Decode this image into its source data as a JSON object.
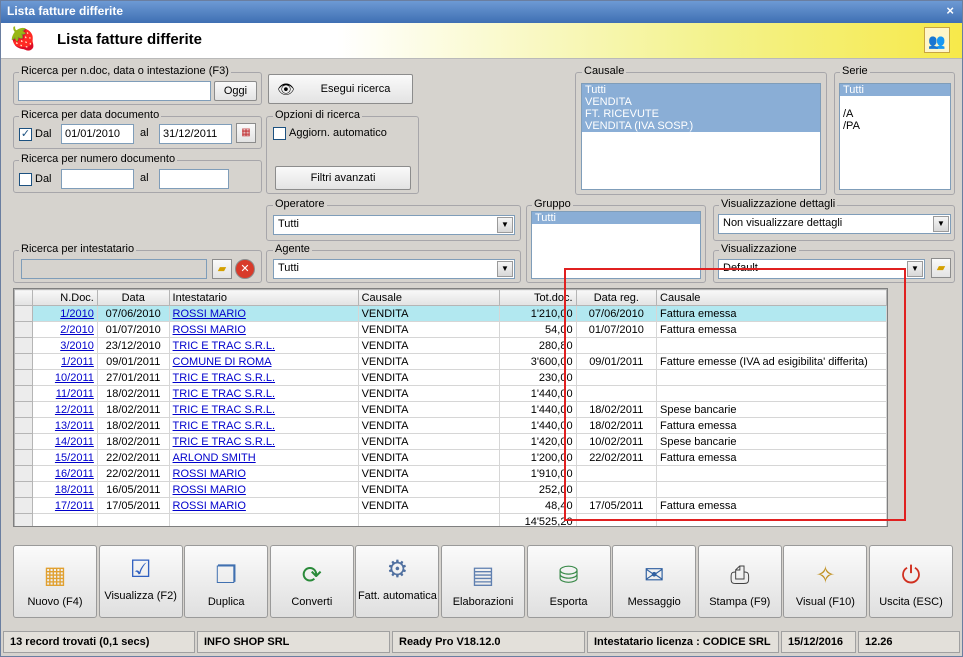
{
  "window": {
    "title": "Lista fatture differite"
  },
  "header": {
    "title": "Lista fatture differite"
  },
  "search": {
    "text_label": "Ricerca per n.doc, data o intestazione (F3)",
    "text_value": "",
    "oggi": "Oggi",
    "execute": "Esegui ricerca",
    "date_label": "Ricerca per data documento",
    "dal": "Dal",
    "al": "al",
    "date_from": "01/01/2010",
    "date_to": "31/12/2011",
    "num_label": "Ricerca per numero documento",
    "num_dal": "Dal",
    "num_al": "al",
    "intest_label": "Ricerca per intestatario"
  },
  "options": {
    "label": "Opzioni di ricerca",
    "auto_update": "Aggiorn. automatico",
    "advanced": "Filtri avanzati"
  },
  "causale": {
    "label": "Causale",
    "items": [
      "Tutti",
      "VENDITA",
      "FT. RICEVUTE",
      "VENDITA (IVA SOSP.)"
    ]
  },
  "serie": {
    "label": "Serie",
    "items": [
      "Tutti",
      "",
      "/A",
      "/PA"
    ]
  },
  "operatore": {
    "label": "Operatore",
    "value": "Tutti"
  },
  "agente": {
    "label": "Agente",
    "value": "Tutti"
  },
  "gruppo": {
    "label": "Gruppo",
    "items": [
      "Tutti"
    ]
  },
  "vis_dettagli": {
    "label": "Visualizzazione dettagli",
    "value": "Non visualizzare dettagli"
  },
  "visualizzazione": {
    "label": "Visualizzazione",
    "value": "Default"
  },
  "table": {
    "columns": [
      "N.Doc.",
      "Data",
      "Intestatario",
      "Causale",
      "Tot.doc.",
      "Data reg.",
      "Causale"
    ],
    "rows": [
      [
        "1/2010",
        "07/06/2010",
        "ROSSI MARIO",
        "VENDITA",
        "1'210,00",
        "07/06/2010",
        "Fattura emessa"
      ],
      [
        "2/2010",
        "01/07/2010",
        "ROSSI MARIO",
        "VENDITA",
        "54,00",
        "01/07/2010",
        "Fattura emessa"
      ],
      [
        "3/2010",
        "23/12/2010",
        "TRIC E TRAC S.R.L.",
        "VENDITA",
        "280,80",
        "",
        ""
      ],
      [
        "1/2011",
        "09/01/2011",
        "COMUNE DI ROMA",
        "VENDITA",
        "3'600,00",
        "09/01/2011",
        "Fatture emesse (IVA ad esigibilita' differita)"
      ],
      [
        "10/2011",
        "27/01/2011",
        "TRIC E TRAC S.R.L.",
        "VENDITA",
        "230,00",
        "",
        ""
      ],
      [
        "11/2011",
        "18/02/2011",
        "TRIC E TRAC S.R.L.",
        "VENDITA",
        "1'440,00",
        "",
        ""
      ],
      [
        "12/2011",
        "18/02/2011",
        "TRIC E TRAC S.R.L.",
        "VENDITA",
        "1'440,00",
        "18/02/2011",
        "Spese bancarie"
      ],
      [
        "13/2011",
        "18/02/2011",
        "TRIC E TRAC S.R.L.",
        "VENDITA",
        "1'440,00",
        "18/02/2011",
        "Fattura emessa"
      ],
      [
        "14/2011",
        "18/02/2011",
        "TRIC E TRAC S.R.L.",
        "VENDITA",
        "1'420,00",
        "10/02/2011",
        "Spese bancarie"
      ],
      [
        "15/2011",
        "22/02/2011",
        "ARLOND SMITH",
        "VENDITA",
        "1'200,00",
        "22/02/2011",
        "Fattura emessa"
      ],
      [
        "16/2011",
        "22/02/2011",
        "ROSSI MARIO",
        "VENDITA",
        "1'910,00",
        "",
        ""
      ],
      [
        "18/2011",
        "16/05/2011",
        "ROSSI MARIO",
        "VENDITA",
        "252,00",
        "",
        ""
      ],
      [
        "17/2011",
        "17/05/2011",
        "ROSSI MARIO",
        "VENDITA",
        "48,40",
        "17/05/2011",
        "Fattura emessa"
      ]
    ],
    "total": "14'525,20"
  },
  "toolbar": [
    {
      "label": "Nuovo (F4)",
      "icon": "new-document-icon"
    },
    {
      "label": "Visualizza (F2)",
      "icon": "view-check-icon"
    },
    {
      "label": "Duplica",
      "icon": "duplicate-icon"
    },
    {
      "label": "Converti",
      "icon": "convert-icon"
    },
    {
      "label": "Fatt. automatica",
      "icon": "gear-icon"
    },
    {
      "label": "Elaborazioni",
      "icon": "processing-icon"
    },
    {
      "label": "Esporta",
      "icon": "export-icon"
    },
    {
      "label": "Messaggio",
      "icon": "message-icon"
    },
    {
      "label": "Stampa (F9)",
      "icon": "printer-icon"
    },
    {
      "label": "Visual (F10)",
      "icon": "magic-wand-icon"
    },
    {
      "label": "Uscita (ESC)",
      "icon": "exit-icon"
    }
  ],
  "status": {
    "records": "13 record trovati (0,1 secs)",
    "company": "INFO SHOP SRL",
    "version": "Ready Pro V18.12.0",
    "license": "Intestatario licenza : CODICE SRL",
    "date": "15/12/2016",
    "time": "12.26"
  }
}
